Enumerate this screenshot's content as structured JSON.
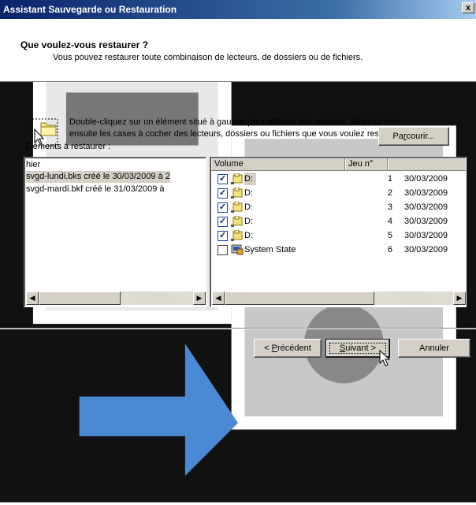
{
  "window": {
    "title": "Assistant Sauvegarde ou Restauration",
    "close_glyph": "x"
  },
  "header": {
    "title": "Que voulez-vous restaurer ?",
    "subtitle": "Vous pouvez restaurer toute combinaison de lecteurs, de dossiers ou de fichiers.",
    "icon": "restore-wizard-icon"
  },
  "instruction": {
    "icon": "folder-cursor-icon",
    "line1": "Double-cliquez sur un élément situé à gauche pour afficher son contenu. Sélectionnez",
    "line2": "ensuite les cases à cocher des lecteurs, dossiers ou fichiers que vous voulez restaurer."
  },
  "items_label": {
    "accel": "É",
    "rest": "léments à restaurer :"
  },
  "browse_button": {
    "pre": "Pa",
    "accel": "r",
    "post": "courir..."
  },
  "left_tree": {
    "header": "hier",
    "items": [
      {
        "label": "svgd-lundi.bks créé le 30/03/2009 à 2",
        "selected": true
      },
      {
        "label": "svgd-mardi.bkf créé le 31/03/2009 à",
        "selected": false
      }
    ]
  },
  "right_list": {
    "columns": [
      "Volume",
      "Jeu n°",
      "("
    ],
    "rows": [
      {
        "checked": true,
        "icon": "drive-icon",
        "name": "D:",
        "set": "1",
        "date": "30/03/2009"
      },
      {
        "checked": true,
        "icon": "drive-icon",
        "name": "D:",
        "set": "2",
        "date": "30/03/2009"
      },
      {
        "checked": true,
        "icon": "drive-icon",
        "name": "D:",
        "set": "3",
        "date": "30/03/2009"
      },
      {
        "checked": true,
        "icon": "drive-icon",
        "name": "D:",
        "set": "4",
        "date": "30/03/2009"
      },
      {
        "checked": true,
        "icon": "drive-icon",
        "name": "D:",
        "set": "5",
        "date": "30/03/2009"
      },
      {
        "checked": false,
        "icon": "system-state-icon",
        "name": "System State",
        "set": "6",
        "date": "30/03/2009"
      }
    ]
  },
  "buttons": {
    "prev": {
      "pre": "< ",
      "accel": "P",
      "post": "récédent"
    },
    "next": {
      "accel": "S",
      "post": "uivant >"
    },
    "cancel": "Annuler"
  },
  "colors": {
    "titlebar": "#0a246a",
    "face": "#d4d0c8",
    "check": "#0a246a"
  }
}
